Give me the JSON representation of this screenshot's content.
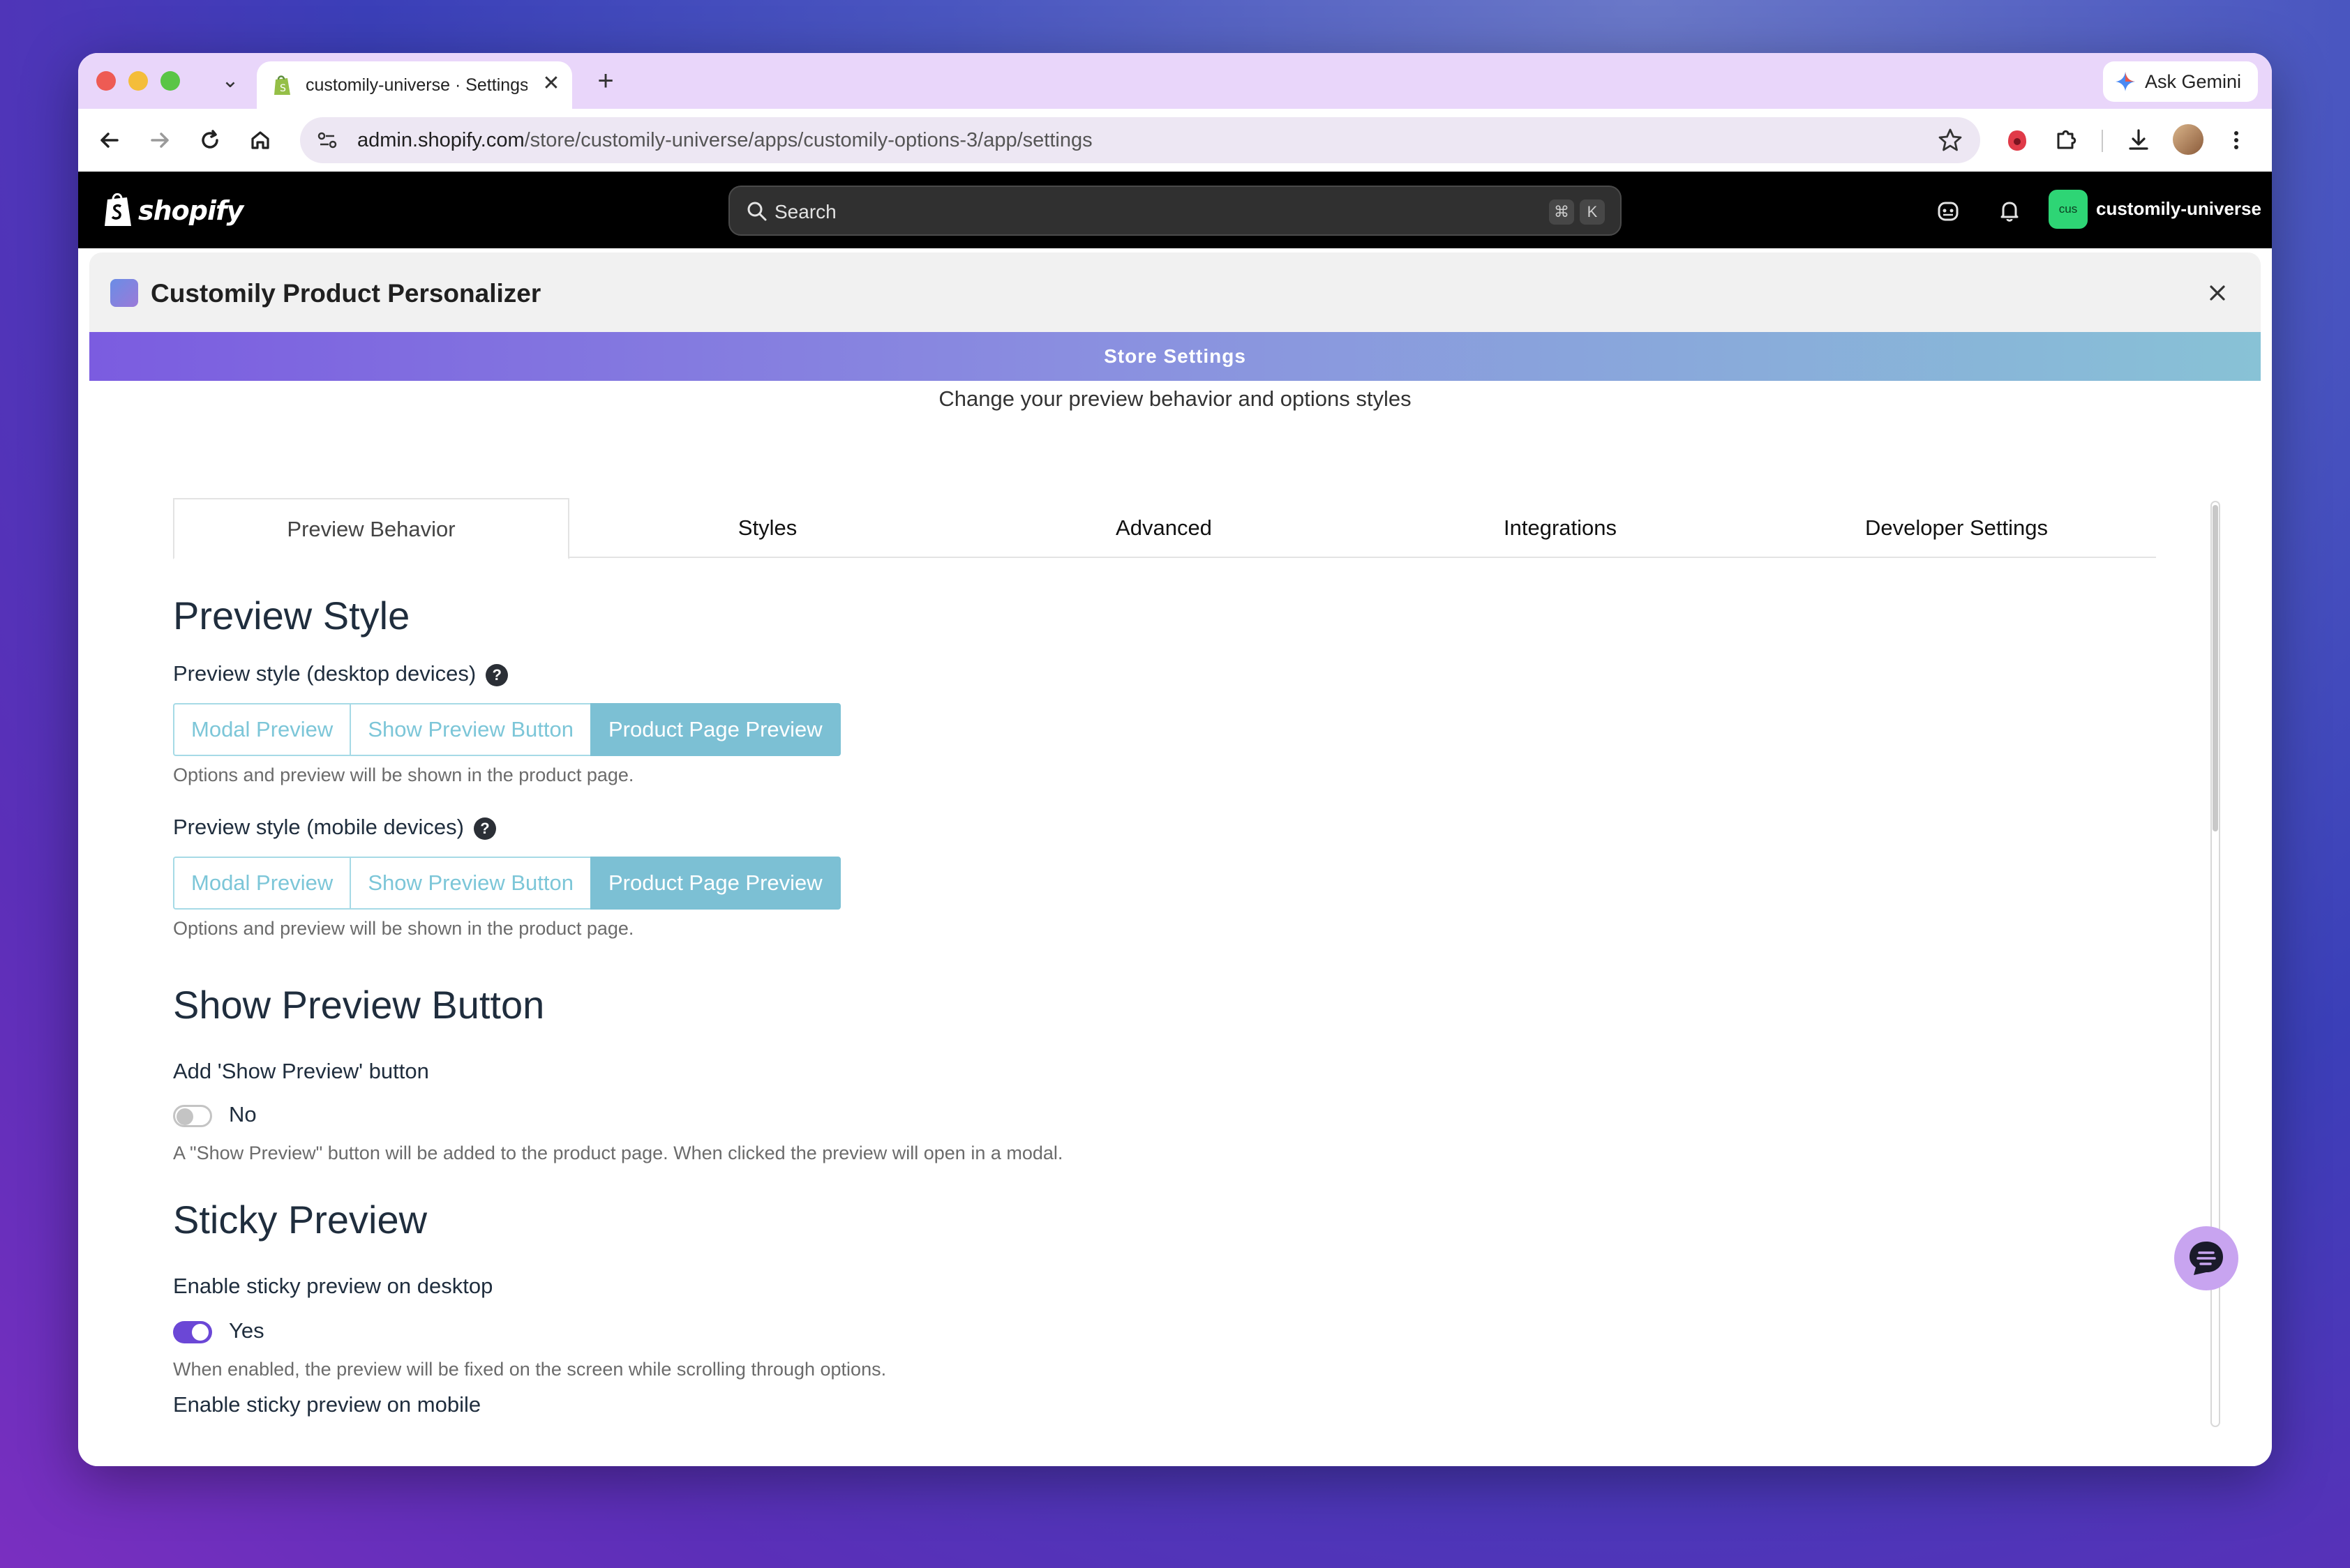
{
  "browser": {
    "tab_title": "customily-universe · Settings · Customily",
    "ask_gemini": "Ask Gemini",
    "url_host": "admin.shopify.com",
    "url_path": "/store/customily-universe/apps/customily-options-3/app/settings"
  },
  "admin": {
    "logo_text": "shopify",
    "search_placeholder": "Search",
    "shortcut_cmd": "⌘",
    "shortcut_key": "K",
    "store_badge": "cus",
    "store_name": "customily-universe"
  },
  "app": {
    "title": "Customily Product Personalizer",
    "banner": "Store Settings",
    "subtitle": "Change your preview behavior and options styles"
  },
  "tabs": [
    {
      "label": "Preview Behavior",
      "active": true
    },
    {
      "label": "Styles",
      "active": false
    },
    {
      "label": "Advanced",
      "active": false
    },
    {
      "label": "Integrations",
      "active": false
    },
    {
      "label": "Developer Settings",
      "active": false
    }
  ],
  "preview_style": {
    "heading": "Preview Style",
    "desktop_label": "Preview style (desktop devices)",
    "mobile_label": "Preview style (mobile devices)",
    "help": "?",
    "options": [
      "Modal Preview",
      "Show Preview Button",
      "Product Page Preview"
    ],
    "desktop_selected": "Product Page Preview",
    "mobile_selected": "Product Page Preview",
    "desktop_hint": "Options and preview will be shown in the product page.",
    "mobile_hint": "Options and preview will be shown in the product page."
  },
  "show_preview_button": {
    "heading": "Show Preview Button",
    "label": "Add 'Show Preview' button",
    "toggle_value": "No",
    "toggle_on": false,
    "hint": "A \"Show Preview\" button will be added to the product page. When clicked the preview will open in a modal."
  },
  "sticky_preview": {
    "heading": "Sticky Preview",
    "desktop_label": "Enable sticky preview on desktop",
    "toggle_value": "Yes",
    "toggle_on": true,
    "hint": "When enabled, the preview will be fixed on the screen while scrolling through options.",
    "mobile_label": "Enable sticky preview on mobile"
  },
  "colors": {
    "accent_purple": "#6b47d6",
    "segment_teal": "#7cc0d4",
    "banner_start": "#7b5ce0",
    "banner_end": "#88c2d6"
  },
  "icons": {
    "back": "arrow-left-icon",
    "forward": "arrow-right-icon",
    "reload": "reload-icon",
    "home": "home-icon",
    "chat": "chat-icon"
  }
}
